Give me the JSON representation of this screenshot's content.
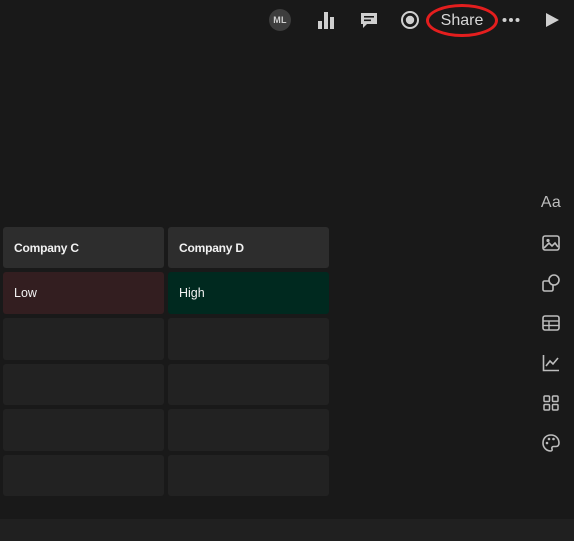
{
  "toolbar": {
    "avatar_initials": "ML",
    "share_label": "Share",
    "icons": [
      "analytics-icon",
      "comment-icon",
      "record-icon",
      "more-icon",
      "play-icon"
    ],
    "highlight_color": "#e41e1e"
  },
  "table": {
    "headers": [
      "Company C",
      "Company D"
    ],
    "rows": [
      [
        "Low",
        "High"
      ],
      [
        "",
        ""
      ],
      [
        "",
        ""
      ],
      [
        "",
        ""
      ],
      [
        "",
        ""
      ]
    ],
    "cell_colors": {
      "low": "#331e20",
      "high": "#00291f"
    }
  },
  "side_tools": {
    "text_tool_label": "Aa",
    "icons": [
      "text-icon",
      "image-icon",
      "shapes-icon",
      "table-icon",
      "chart-icon",
      "apps-icon",
      "palette-icon"
    ]
  }
}
